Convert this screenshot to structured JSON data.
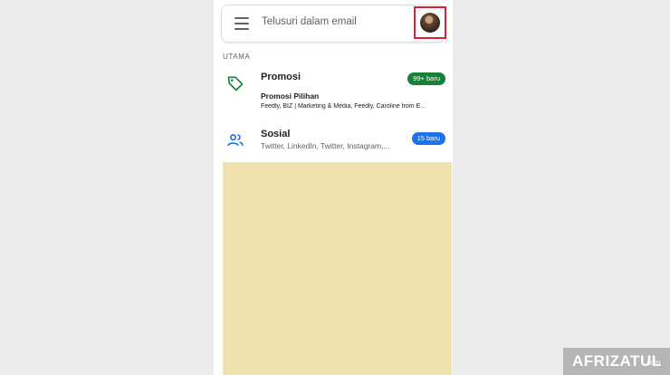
{
  "search": {
    "placeholder": "Telusuri dalam email"
  },
  "section": {
    "label": "UTAMA"
  },
  "categories": [
    {
      "title": "Promosi",
      "badge": "99+ baru",
      "badge_color": "#188038",
      "icon": "tag-icon",
      "highlight_title": "Promosi Pilihan",
      "senders": "Feedly, BIZ | Marketing & Media, Feedly, Caroline from E..."
    },
    {
      "title": "Sosial",
      "badge": "15 baru",
      "badge_color": "#1a73e8",
      "icon": "people-icon",
      "senders": "Twitter, LinkedIn, Twitter, Instagram,..."
    }
  ],
  "watermark": {
    "main": "AFRIZATUL",
    "suffix": ".com"
  }
}
